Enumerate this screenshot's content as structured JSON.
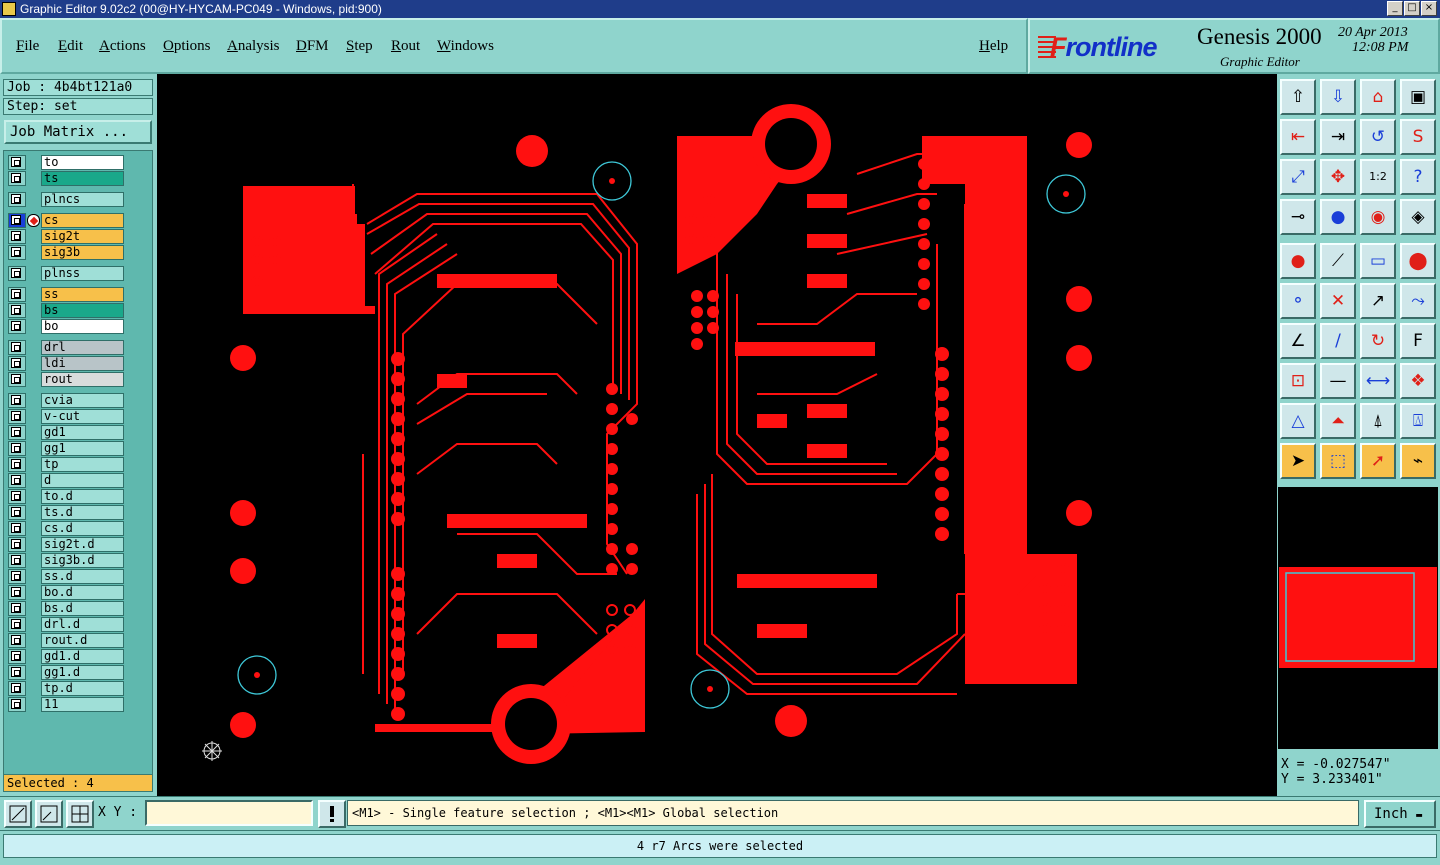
{
  "window": {
    "title": "Graphic Editor 9.02c2 (00@HY-HYCAM-PC049 - Windows, pid:900)"
  },
  "menu": [
    "File",
    "Edit",
    "Actions",
    "Options",
    "Analysis",
    "DFM",
    "Step",
    "Rout",
    "Windows"
  ],
  "help_label": "Help",
  "brand": {
    "logo": "rontline",
    "logo_f": "F",
    "product": "Genesis 2000",
    "subtitle": "Graphic Editor",
    "date": "20 Apr 2013",
    "time": "12:08 PM"
  },
  "job": {
    "label": "Job : 4b4bt121a0",
    "step": "Step: set",
    "matrix_button": "Job Matrix ..."
  },
  "layers": [
    {
      "name": "to",
      "color": "#ffffff",
      "checked": false
    },
    {
      "name": "ts",
      "color": "#1aa88a",
      "checked": false
    },
    {
      "name": "plncs",
      "color": "#9fdfd7",
      "checked": false
    },
    {
      "name": "cs",
      "color": "#f7c04a",
      "checked": true,
      "affected": true
    },
    {
      "name": "sig2t",
      "color": "#f7c04a",
      "checked": false
    },
    {
      "name": "sig3b",
      "color": "#f7c04a",
      "checked": false
    },
    {
      "name": "plnss",
      "color": "#9fdfd7",
      "checked": false
    },
    {
      "name": "ss",
      "color": "#f7c04a",
      "checked": false
    },
    {
      "name": "bs",
      "color": "#1aa88a",
      "checked": false
    },
    {
      "name": "bo",
      "color": "#ffffff",
      "checked": false
    },
    {
      "name": "drl",
      "color": "#b8c4c8",
      "checked": false
    },
    {
      "name": "ldi",
      "color": "#b8c4c8",
      "checked": false
    },
    {
      "name": "rout",
      "color": "#d8dcdc",
      "checked": false
    },
    {
      "name": "cvia",
      "color": "#9fdfd7",
      "checked": false
    },
    {
      "name": "v-cut",
      "color": "#9fdfd7",
      "checked": false
    },
    {
      "name": "gd1",
      "color": "#9fdfd7",
      "checked": false
    },
    {
      "name": "gg1",
      "color": "#9fdfd7",
      "checked": false
    },
    {
      "name": "tp",
      "color": "#9fdfd7",
      "checked": false
    },
    {
      "name": "d",
      "color": "#9fdfd7",
      "checked": false
    },
    {
      "name": "to.d",
      "color": "#9fdfd7",
      "checked": false,
      "edit": true
    },
    {
      "name": "ts.d",
      "color": "#9fdfd7",
      "checked": false
    },
    {
      "name": "cs.d",
      "color": "#9fdfd7",
      "checked": false,
      "edit": true
    },
    {
      "name": "sig2t.d",
      "color": "#9fdfd7",
      "checked": false,
      "edit": true
    },
    {
      "name": "sig3b.d",
      "color": "#9fdfd7",
      "checked": false,
      "edit": true
    },
    {
      "name": "ss.d",
      "color": "#9fdfd7",
      "checked": false,
      "edit": true
    },
    {
      "name": "bo.d",
      "color": "#9fdfd7",
      "checked": false
    },
    {
      "name": "bs.d",
      "color": "#9fdfd7",
      "checked": false
    },
    {
      "name": "drl.d",
      "color": "#9fdfd7",
      "checked": false
    },
    {
      "name": "rout.d",
      "color": "#9fdfd7",
      "checked": false
    },
    {
      "name": "gd1.d",
      "color": "#9fdfd7",
      "checked": false,
      "edit": true
    },
    {
      "name": "gg1.d",
      "color": "#9fdfd7",
      "checked": false
    },
    {
      "name": "tp.d",
      "color": "#9fdfd7",
      "checked": false
    },
    {
      "name": "11",
      "color": "#9fdfd7",
      "checked": false
    }
  ],
  "selected_label": "Selected : 4",
  "coords": {
    "x": "X = -0.027547\"",
    "y": "Y = 3.233401\""
  },
  "bottom": {
    "xy_label": "X Y :",
    "xy_value": "",
    "hint": "<M1> - Single feature selection ; <M1><M1> Global selection",
    "unit": "Inch"
  },
  "status": "4 r7 Arcs were selected",
  "colors": {
    "copper": "#ff1010",
    "panel": "#8fd4cc",
    "highlight": "#f7c04a",
    "outline": "#3ec8d8"
  },
  "tool_icons": [
    "import-icon",
    "export-icon",
    "home-icon",
    "window-icon",
    "pan-left-icon",
    "pan-right-icon",
    "zoom-back-icon",
    "redraw-icon",
    "fit-icon",
    "center-icon",
    "scale-1to2-icon",
    "query-icon",
    "measure-icon",
    "probe-icon",
    "layer-display-icon",
    "layer-color-icon",
    "select-icon",
    "draw-line-icon",
    "ruler-icon",
    "pad-icon",
    "connect-icon",
    "delete-icon",
    "move-icon",
    "copy-icon",
    "angle-icon",
    "line-icon",
    "arc-icon",
    "text-icon",
    "snap-icon",
    "split-icon",
    "resize-icon",
    "shapes-icon",
    "triangle-add-icon",
    "triangle-up-icon",
    "triangle-edit-icon",
    "triangle-move-icon",
    "pointer-icon",
    "select-box-icon",
    "pointer-alt-icon",
    "route-icon"
  ]
}
